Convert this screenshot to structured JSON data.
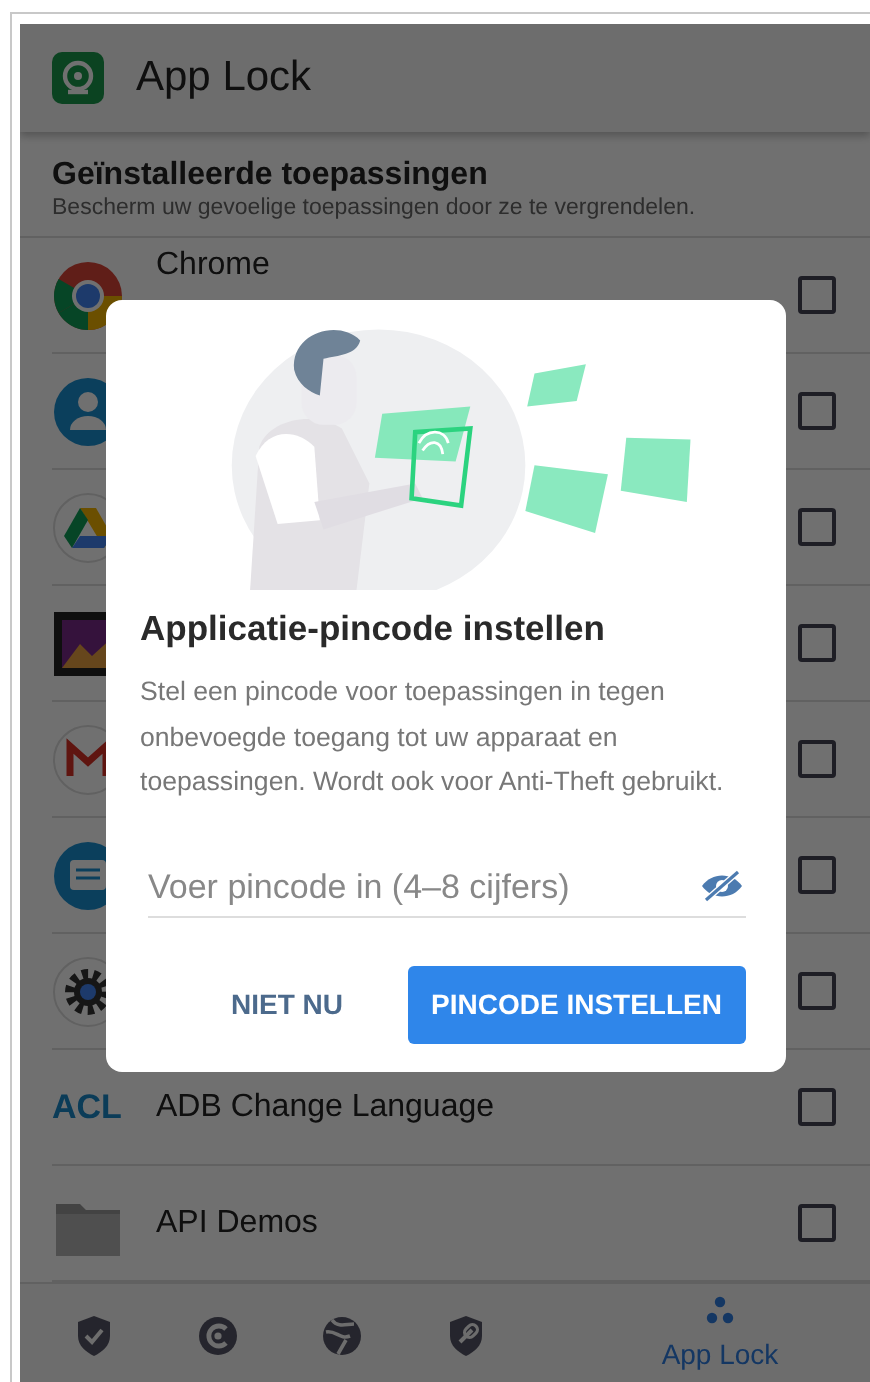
{
  "app_bar": {
    "title": "App Lock"
  },
  "section": {
    "title": "Geïnstalleerde toepassingen",
    "subtitle": "Bescherm uw gevoelige toepassingen door ze te vergrendelen."
  },
  "apps": [
    {
      "kind": "chrome",
      "name": "Chrome",
      "checked": false
    },
    {
      "kind": "contacts",
      "checked": false
    },
    {
      "kind": "drive",
      "checked": false
    },
    {
      "kind": "gallery",
      "checked": false
    },
    {
      "kind": "gmail",
      "checked": false
    },
    {
      "kind": "messages",
      "checked": false
    },
    {
      "kind": "settings",
      "checked": false
    },
    {
      "kind": "acl",
      "icon_text": "ACL",
      "name": "ADB Change Language",
      "checked": false
    },
    {
      "kind": "folder",
      "name": "API Demos",
      "checked": false
    }
  ],
  "dialog": {
    "title": "Applicatie-pincode instellen",
    "body": "Stel een pincode voor toepassingen in tegen onbevoegde toegang tot uw apparaat en toepassingen. Wordt ook voor Anti-Theft gebruikt.",
    "pin_field": {
      "placeholder": "Voer pincode in (4–8 cijfers)"
    },
    "buttons": [
      {
        "kind": "text",
        "label": "NIET NU"
      },
      {
        "kind": "primary",
        "label": "PINCODE INSTELLEN"
      }
    ]
  },
  "bottom_nav": [
    {
      "kind": "shield-check",
      "selected": false
    },
    {
      "kind": "c-circle",
      "selected": false
    },
    {
      "kind": "globe",
      "selected": false
    },
    {
      "kind": "shield-link",
      "selected": false
    },
    {
      "kind": "dots",
      "label": "App Lock",
      "selected": true
    }
  ]
}
